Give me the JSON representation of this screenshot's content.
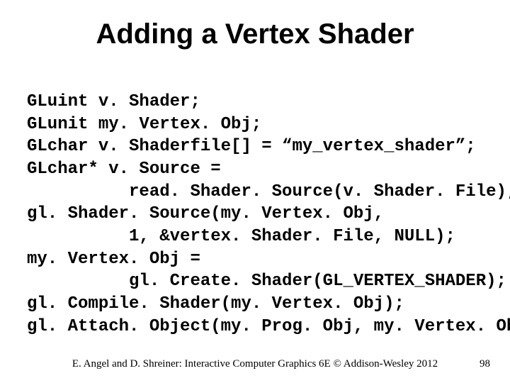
{
  "title": "Adding a Vertex Shader",
  "code": "GLuint v. Shader;\nGLunit my. Vertex. Obj;\nGLchar v. Shaderfile[] = “my_vertex_shader”;\nGLchar* v. Source =\n          read. Shader. Source(v. Shader. File);\ngl. Shader. Source(my. Vertex. Obj,\n          1, &vertex. Shader. File, NULL);\nmy. Vertex. Obj =\n          gl. Create. Shader(GL_VERTEX_SHADER);\ngl. Compile. Shader(my. Vertex. Obj);\ngl. Attach. Object(my. Prog. Obj, my. Vertex. Obj);",
  "footer": {
    "citation": "E. Angel and D. Shreiner: Interactive Computer Graphics 6E © Addison-Wesley 2012",
    "page": "98"
  }
}
